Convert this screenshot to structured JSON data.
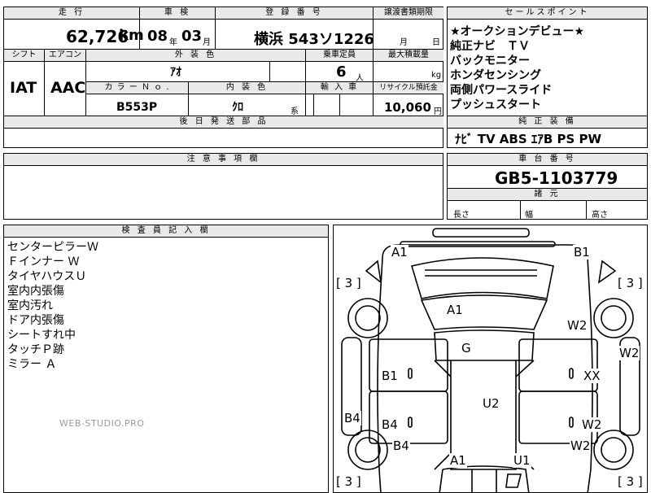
{
  "headers": {
    "mileage": "走 行",
    "inspection": "車 検",
    "registration": "登 録 番 号",
    "transfer_date": "譲渡書類期限",
    "sales_points": "セールスポイント",
    "shift": "シフト",
    "aircon": "エアコン",
    "exterior_color": "外 装 色",
    "capacity": "乗車定員",
    "max_load": "最大積載量",
    "color_no": "カ ラ ー Ｎ ｏ .",
    "interior_color": "内 装 色",
    "import": "輸 入 車",
    "recycle": "リサイクル預託金",
    "later_parts": "後 日 発 送 部 品",
    "equipment": "純 正 装 備",
    "notes": "注 意 事 項 欄",
    "chassis": "車 台 番 号",
    "dimensions": "諸 元",
    "inspector": "検 査 員 記 入 欄"
  },
  "mileage": {
    "value": "62,726",
    "unit": "km"
  },
  "inspection": {
    "year": "08",
    "year_unit": "年",
    "month": "03",
    "month_unit": "月"
  },
  "registration": {
    "value": "横浜  543ソ1226"
  },
  "transfer": {
    "month_unit": "月",
    "day_unit": "日"
  },
  "sales_points": [
    "★オークションデビュー★",
    "純正ナビ　ＴＶ",
    "バックモニター",
    "ホンダセンシング",
    "両側パワースライド",
    "プッシュスタート"
  ],
  "shift": {
    "value": "IAT"
  },
  "aircon": {
    "value": "AAC"
  },
  "exterior_color": {
    "value": "ｱｵ"
  },
  "capacity": {
    "value": "6",
    "unit": "人"
  },
  "max_load": {
    "unit": "kg"
  },
  "color_no": {
    "value": "B553P"
  },
  "interior_color": {
    "value": "ｸﾛ",
    "suffix": "系"
  },
  "recycle": {
    "value": "10,060",
    "unit": "円"
  },
  "equipment": {
    "value": "ﾅﾋﾞ  TV  ABS  ｴｱB  PS  PW"
  },
  "chassis": {
    "value": "GB5-1103779"
  },
  "dimensions": {
    "length": "長さ",
    "width": "幅",
    "height": "高さ"
  },
  "inspector_notes": [
    "センターピラーＷ",
    "Ｆインナー Ｗ",
    "タイヤハウスＵ",
    "室内内張傷",
    "室内汚れ",
    "ドア内張傷",
    "シートすれ中",
    "タッチＰ跡",
    "ミラー Ａ"
  ],
  "watermark": "WEB-STUDIO.PRO",
  "diagram": {
    "tread_tl": "[ 3 ]",
    "tread_tr": "[ 3 ]",
    "tread_bl": "[ 3 ]",
    "tread_br": "[ 3 ]",
    "bumper_l": "A1",
    "bumper_r": "B1",
    "hood": "A1",
    "fender_r": "W2",
    "side_r": "W2",
    "roof": "G",
    "door_lf": "B1",
    "door_rf": "XX",
    "side_l": "B4",
    "door_lr": "B4",
    "door_rr": "W2",
    "rear_l": "B4",
    "rear_r": "W2",
    "center": "U2",
    "tail_l": "A1",
    "tail_r": "U1"
  }
}
